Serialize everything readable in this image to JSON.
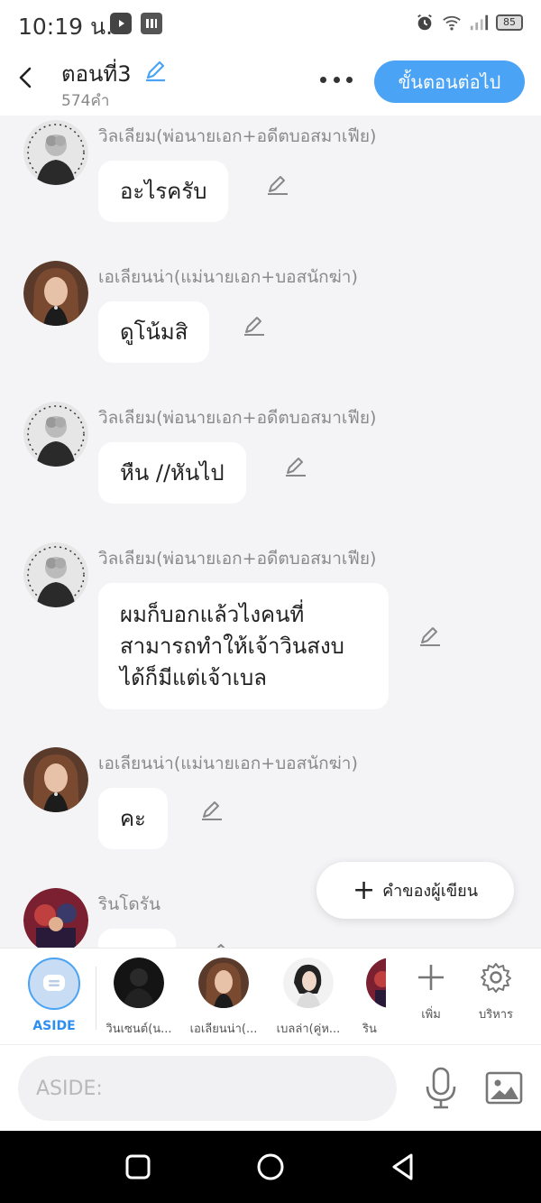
{
  "status_bar": {
    "time": "10:19 น.",
    "battery": "85"
  },
  "header": {
    "title": "ตอนที่3",
    "word_count": "574คำ",
    "next_label": "ขั้นตอนต่อไป"
  },
  "messages": [
    {
      "sender": "วิลเลียม(พ่อนายเอก+อดีตบอสมาเฟีย)",
      "text": "อะไรครับ"
    },
    {
      "sender": "เอเลียนน่า(แม่นายเอก+บอสนักฆ่า)",
      "text": "ดูโน้มสิ"
    },
    {
      "sender": "วิลเลียม(พ่อนายเอก+อดีตบอสมาเฟีย)",
      "text": "หืน //หันไป"
    },
    {
      "sender": "วิลเลียม(พ่อนายเอก+อดีตบอสมาเฟีย)",
      "text": "ผมก็บอกแล้วไงคนที่\nสามารถทำให้เจ้าวินสงบ\nได้ก็มีแต่เจ้าเบล"
    },
    {
      "sender": "เอเลียนน่า(แม่นายเอก+บอสนักฆ่า)",
      "text": "คะ"
    },
    {
      "sender": "รินโดรัน",
      "text": ""
    }
  ],
  "fab": {
    "label": "คำของผู้เขียน"
  },
  "characters": {
    "aside_label": "ASIDE",
    "items": [
      {
        "label": "วินเซนต์(น..."
      },
      {
        "label": "เอเลียนน่า(..."
      },
      {
        "label": "เบลล่า(คู่ห..."
      },
      {
        "label": "ริน"
      }
    ],
    "add_label": "เพิ่ม",
    "manage_label": "บริหาร"
  },
  "input": {
    "placeholder": "ASIDE:"
  },
  "icons": [
    "back-icon",
    "edit-icon",
    "more-icon",
    "plus-icon",
    "gear-icon",
    "mic-icon",
    "image-icon",
    "home-icon",
    "recents-icon",
    "nav-back-icon"
  ],
  "colors": {
    "accent": "#4aa3f4",
    "aside": "#2e8ef0",
    "background": "#f4f4f6"
  }
}
